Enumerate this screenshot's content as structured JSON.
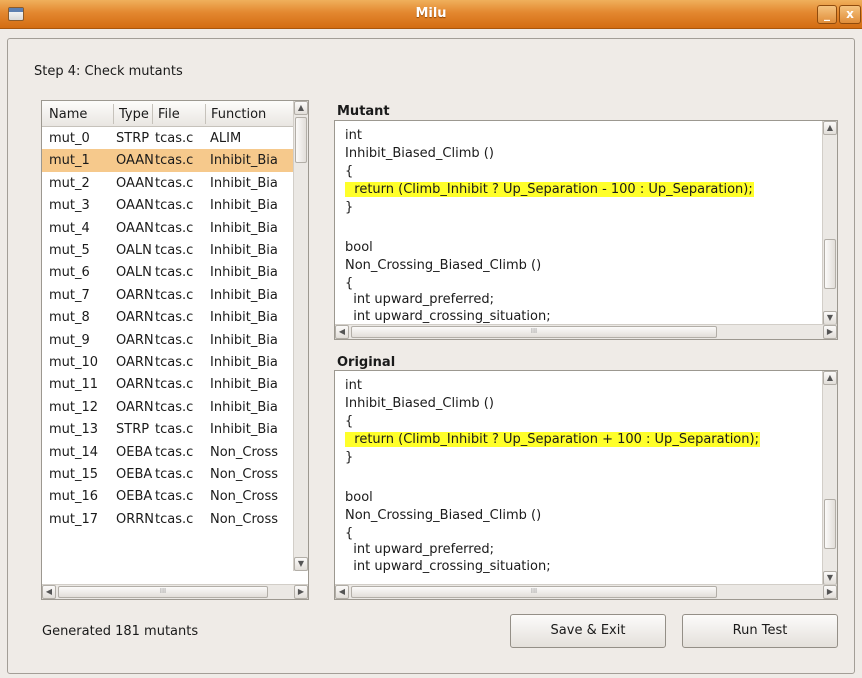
{
  "window": {
    "title": "Milu"
  },
  "step_label": "Step 4: Check mutants",
  "list": {
    "headers": {
      "name": "Name",
      "type": "Type",
      "file": "File",
      "function": "Function"
    },
    "rows": [
      {
        "name": "mut_0",
        "type": "STRP",
        "file": "tcas.c",
        "function": "ALIM"
      },
      {
        "name": "mut_1",
        "type": "OAAN",
        "file": "tcas.c",
        "function": "Inhibit_Bia"
      },
      {
        "name": "mut_2",
        "type": "OAAN",
        "file": "tcas.c",
        "function": "Inhibit_Bia"
      },
      {
        "name": "mut_3",
        "type": "OAAN",
        "file": "tcas.c",
        "function": "Inhibit_Bia"
      },
      {
        "name": "mut_4",
        "type": "OAAN",
        "file": "tcas.c",
        "function": "Inhibit_Bia"
      },
      {
        "name": "mut_5",
        "type": "OALN",
        "file": "tcas.c",
        "function": "Inhibit_Bia"
      },
      {
        "name": "mut_6",
        "type": "OALN",
        "file": "tcas.c",
        "function": "Inhibit_Bia"
      },
      {
        "name": "mut_7",
        "type": "OARN",
        "file": "tcas.c",
        "function": "Inhibit_Bia"
      },
      {
        "name": "mut_8",
        "type": "OARN",
        "file": "tcas.c",
        "function": "Inhibit_Bia"
      },
      {
        "name": "mut_9",
        "type": "OARN",
        "file": "tcas.c",
        "function": "Inhibit_Bia"
      },
      {
        "name": "mut_10",
        "type": "OARN",
        "file": "tcas.c",
        "function": "Inhibit_Bia"
      },
      {
        "name": "mut_11",
        "type": "OARN",
        "file": "tcas.c",
        "function": "Inhibit_Bia"
      },
      {
        "name": "mut_12",
        "type": "OARN",
        "file": "tcas.c",
        "function": "Inhibit_Bia"
      },
      {
        "name": "mut_13",
        "type": "STRP",
        "file": "tcas.c",
        "function": "Inhibit_Bia"
      },
      {
        "name": "mut_14",
        "type": "OEBA",
        "file": "tcas.c",
        "function": "Non_Cross"
      },
      {
        "name": "mut_15",
        "type": "OEBA",
        "file": "tcas.c",
        "function": "Non_Cross"
      },
      {
        "name": "mut_16",
        "type": "OEBA",
        "file": "tcas.c",
        "function": "Non_Cross"
      },
      {
        "name": "mut_17",
        "type": "ORRN",
        "file": "tcas.c",
        "function": "Non_Cross"
      }
    ]
  },
  "mutant": {
    "title": "Mutant",
    "lines": [
      "int",
      "Inhibit_Biased_Climb ()",
      "{",
      "  return (Climb_Inhibit ? Up_Separation - 100 : Up_Separation);",
      "}",
      "",
      "bool",
      "Non_Crossing_Biased_Climb ()",
      "{",
      "  int upward_preferred;",
      "  int upward_crossing_situation;"
    ]
  },
  "original": {
    "title": "Original",
    "lines": [
      "int",
      "Inhibit_Biased_Climb ()",
      "{",
      "  return (Climb_Inhibit ? Up_Separation + 100 : Up_Separation);",
      "}",
      "",
      "bool",
      "Non_Crossing_Biased_Climb ()",
      "{",
      "  int upward_preferred;",
      "  int upward_crossing_situation;"
    ]
  },
  "status_text": "Generated 181 mutants",
  "buttons": {
    "save_exit": "Save & Exit",
    "run_test": "Run Test"
  },
  "glyphs": {
    "min": "_",
    "close": "x",
    "up": "▲",
    "down": "▼",
    "left": "◀",
    "right": "▶",
    "grip": "III"
  }
}
